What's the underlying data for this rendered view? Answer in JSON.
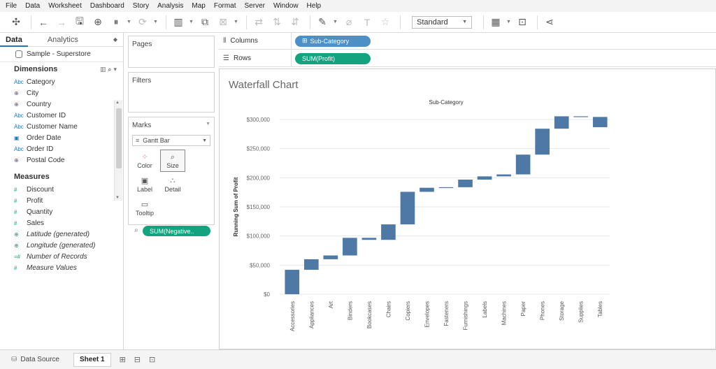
{
  "menu": [
    "File",
    "Data",
    "Worksheet",
    "Dashboard",
    "Story",
    "Analysis",
    "Map",
    "Format",
    "Server",
    "Window",
    "Help"
  ],
  "toolbar": {
    "fit_select": "Standard"
  },
  "data_pane": {
    "tab_data": "Data",
    "tab_analytics": "Analytics",
    "datasource": "Sample - Superstore",
    "dimensions_header": "Dimensions",
    "dimensions": [
      {
        "type": "Abc",
        "name": "Category"
      },
      {
        "type": "geo",
        "name": "City"
      },
      {
        "type": "geo",
        "name": "Country"
      },
      {
        "type": "Abc",
        "name": "Customer ID"
      },
      {
        "type": "Abc",
        "name": "Customer Name"
      },
      {
        "type": "date",
        "name": "Order Date"
      },
      {
        "type": "Abc",
        "name": "Order ID"
      },
      {
        "type": "geo",
        "name": "Postal Code"
      }
    ],
    "measures_header": "Measures",
    "measures": [
      {
        "type": "#",
        "name": "Discount"
      },
      {
        "type": "#",
        "name": "Profit"
      },
      {
        "type": "#",
        "name": "Quantity"
      },
      {
        "type": "#",
        "name": "Sales"
      },
      {
        "type": "geo",
        "name": "Latitude (generated)"
      },
      {
        "type": "geo",
        "name": "Longitude (generated)"
      },
      {
        "type": "=#",
        "name": "Number of Records"
      },
      {
        "type": "#",
        "name": "Measure Values"
      }
    ]
  },
  "cards": {
    "pages": "Pages",
    "filters": "Filters",
    "marks": "Marks",
    "mark_type": "Gantt Bar",
    "mark_buttons": [
      "Color",
      "Size",
      "Label",
      "Detail",
      "Tooltip"
    ],
    "size_pill": "SUM(Negative.."
  },
  "shelves": {
    "columns_label": "Columns",
    "columns_pill": "Sub-Category",
    "rows_label": "Rows",
    "rows_pill": "SUM(Profit)"
  },
  "viz": {
    "title": "Waterfall Chart"
  },
  "chart_data": {
    "type": "bar",
    "subtype": "waterfall",
    "title": "Waterfall Chart",
    "xlabel": "Sub-Category",
    "ylabel": "Running Sum of Profit",
    "ylim": [
      0,
      300000
    ],
    "y_ticks": [
      "$0",
      "$50,000",
      "$100,000",
      "$150,000",
      "$200,000",
      "$250,000",
      "$300,000"
    ],
    "y_tick_values": [
      0,
      50000,
      100000,
      150000,
      200000,
      250000,
      300000
    ],
    "color": "#4e79a7",
    "categories": [
      "Accessories",
      "Appliances",
      "Art",
      "Binders",
      "Bookcases",
      "Chairs",
      "Copiers",
      "Envelopes",
      "Fasteners",
      "Furnishings",
      "Labels",
      "Machines",
      "Paper",
      "Phones",
      "Storage",
      "Supplies",
      "Tables"
    ],
    "start": [
      0,
      41937,
      60056,
      66583,
      96805,
      93332,
      119923,
      175835,
      182799,
      183749,
      196808,
      202354,
      205738,
      239717,
      284232,
      305511,
      304386
    ],
    "end": [
      41937,
      60056,
      66583,
      96805,
      93332,
      119923,
      175835,
      182799,
      183749,
      196808,
      202354,
      205738,
      239717,
      284232,
      305511,
      304386,
      286784
    ]
  },
  "bottom_tabs": {
    "data_source": "Data Source",
    "sheet": "Sheet 1"
  }
}
